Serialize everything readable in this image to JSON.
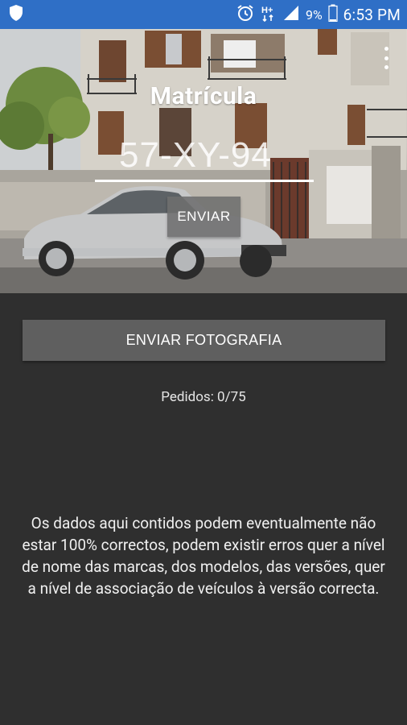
{
  "status_bar": {
    "shield_icon": "shield-icon",
    "alarm_icon": "alarm-icon",
    "network_type": "H+",
    "battery_percent": "9%",
    "time": "6:53 PM",
    "background": "#2f6fc6"
  },
  "header": {
    "title": "Matrícula",
    "overflow_icon": "more-vertical-icon"
  },
  "plate_input": {
    "placeholder": "57-XY-94"
  },
  "send_button": {
    "label": "ENVIAR"
  },
  "photo_button": {
    "label": "ENVIAR FOTOGRAFIA"
  },
  "requests_text": "Pedidos: 0/75",
  "disclaimer": "Os dados aqui contidos podem eventualmente não estar 100% correctos, podem existir erros quer a nível de nome das marcas, dos modelos, das versões, quer a nível de associação de veículos à versão correcta.",
  "colors": {
    "background": "#2f2f2f",
    "button": "#5f5f5f",
    "text": "#ffffff"
  }
}
